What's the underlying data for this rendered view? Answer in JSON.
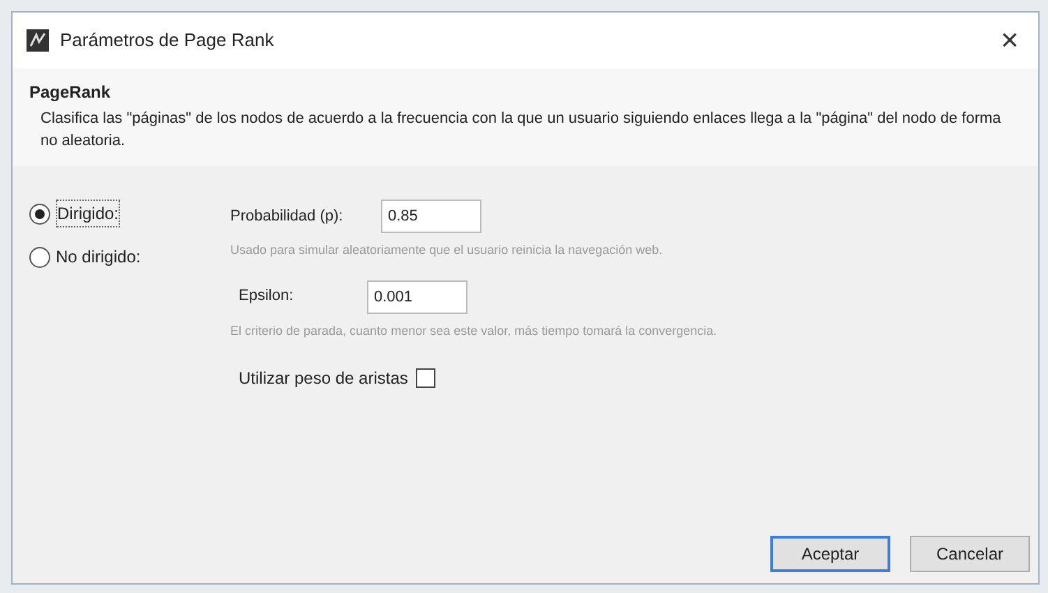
{
  "window": {
    "title": "Parámetros de Page Rank",
    "close": "×"
  },
  "header": {
    "title": "PageRank",
    "description": "Clasifica las \"páginas\" de los nodos de acuerdo a la frecuencia con la que un usuario siguiendo enlaces llega a la \"página\" del nodo de forma no aleatoria."
  },
  "modes": [
    {
      "label": "Dirigido:",
      "selected": true
    },
    {
      "label": "No dirigido:",
      "selected": false
    }
  ],
  "params": [
    {
      "label": "Probabilidad (p):",
      "value": "0.85",
      "help": "Usado para simular aleatoriamente que el usuario reinicia la navegación web."
    },
    {
      "label": "Epsilon:",
      "value": "0.001",
      "help": "El criterio de parada, cuanto menor sea este valor, más tiempo tomará la convergencia."
    }
  ],
  "edge_weight": {
    "label": "Utilizar peso de aristas",
    "checked": false
  },
  "buttons": [
    {
      "label": "Aceptar",
      "kind": "default"
    },
    {
      "label": "Cancelar",
      "kind": "normal"
    }
  ]
}
